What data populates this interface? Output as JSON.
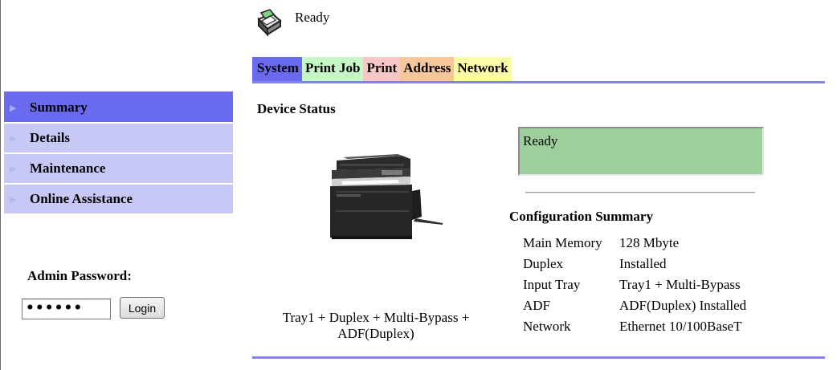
{
  "status": {
    "icon": "printer-status-icon",
    "text": "Ready"
  },
  "tabs": [
    {
      "label": "System",
      "active": true
    },
    {
      "label": "Print Job"
    },
    {
      "label": "Print"
    },
    {
      "label": "Address"
    },
    {
      "label": "Network"
    }
  ],
  "sidebar": {
    "items": [
      {
        "label": "Summary",
        "active": true
      },
      {
        "label": "Details"
      },
      {
        "label": "Maintenance"
      },
      {
        "label": "Online Assistance"
      }
    ]
  },
  "admin": {
    "label": "Admin Password:",
    "password_value": "••••••",
    "login_label": "Login"
  },
  "device": {
    "title": "Device Status",
    "status_box": "Ready",
    "caption": "Tray1 + Duplex + Multi-Bypass + ADF(Duplex)"
  },
  "config": {
    "title": "Configuration Summary",
    "rows": [
      {
        "label": "Main Memory",
        "value": "128 Mbyte"
      },
      {
        "label": "Duplex",
        "value": "Installed"
      },
      {
        "label": "Input Tray",
        "value": "Tray1 + Multi-Bypass"
      },
      {
        "label": "ADF",
        "value": "ADF(Duplex) Installed"
      },
      {
        "label": "Network",
        "value": "Ethernet 10/100BaseT"
      }
    ]
  },
  "colors": {
    "accent": "#6a6af0",
    "sidebar_bg": "#c8c8f7",
    "ready_bg": "#9ccf9c"
  }
}
